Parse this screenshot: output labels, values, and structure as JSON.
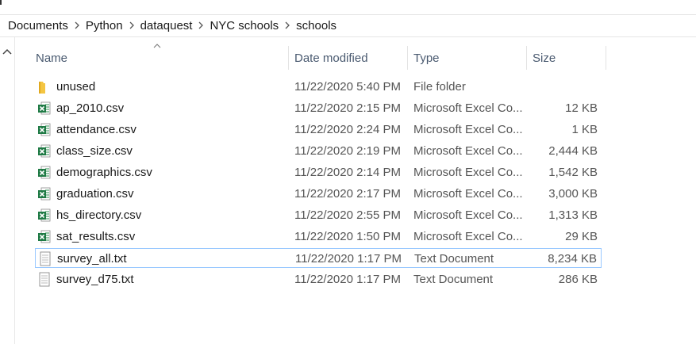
{
  "breadcrumb": [
    "Documents",
    "Python",
    "dataquest",
    "NYC schools",
    "schools"
  ],
  "columns": {
    "name": "Name",
    "date": "Date modified",
    "type": "Type",
    "size": "Size"
  },
  "files": [
    {
      "name": "unused",
      "date": "11/22/2020 5:40 PM",
      "type": "File folder",
      "size": "",
      "icon": "folder-icon"
    },
    {
      "name": "ap_2010.csv",
      "date": "11/22/2020 2:15 PM",
      "type": "Microsoft Excel Co...",
      "size": "12 KB",
      "icon": "excel-csv-icon"
    },
    {
      "name": "attendance.csv",
      "date": "11/22/2020 2:24 PM",
      "type": "Microsoft Excel Co...",
      "size": "1 KB",
      "icon": "excel-csv-icon"
    },
    {
      "name": "class_size.csv",
      "date": "11/22/2020 2:19 PM",
      "type": "Microsoft Excel Co...",
      "size": "2,444 KB",
      "icon": "excel-csv-icon"
    },
    {
      "name": "demographics.csv",
      "date": "11/22/2020 2:14 PM",
      "type": "Microsoft Excel Co...",
      "size": "1,542 KB",
      "icon": "excel-csv-icon"
    },
    {
      "name": "graduation.csv",
      "date": "11/22/2020 2:17 PM",
      "type": "Microsoft Excel Co...",
      "size": "3,000 KB",
      "icon": "excel-csv-icon"
    },
    {
      "name": "hs_directory.csv",
      "date": "11/22/2020 2:55 PM",
      "type": "Microsoft Excel Co...",
      "size": "1,313 KB",
      "icon": "excel-csv-icon"
    },
    {
      "name": "sat_results.csv",
      "date": "11/22/2020 1:50 PM",
      "type": "Microsoft Excel Co...",
      "size": "29 KB",
      "icon": "excel-csv-icon"
    },
    {
      "name": "survey_all.txt",
      "date": "11/22/2020 1:17 PM",
      "type": "Text Document",
      "size": "8,234 KB",
      "icon": "text-document-icon",
      "selected": true
    },
    {
      "name": "survey_d75.txt",
      "date": "11/22/2020 1:17 PM",
      "type": "Text Document",
      "size": "286 KB",
      "icon": "text-document-icon"
    }
  ],
  "colors": {
    "accent_border": "#99c8ff",
    "excel_green": "#1f7a45",
    "folder_yellow": "#f4c542"
  }
}
